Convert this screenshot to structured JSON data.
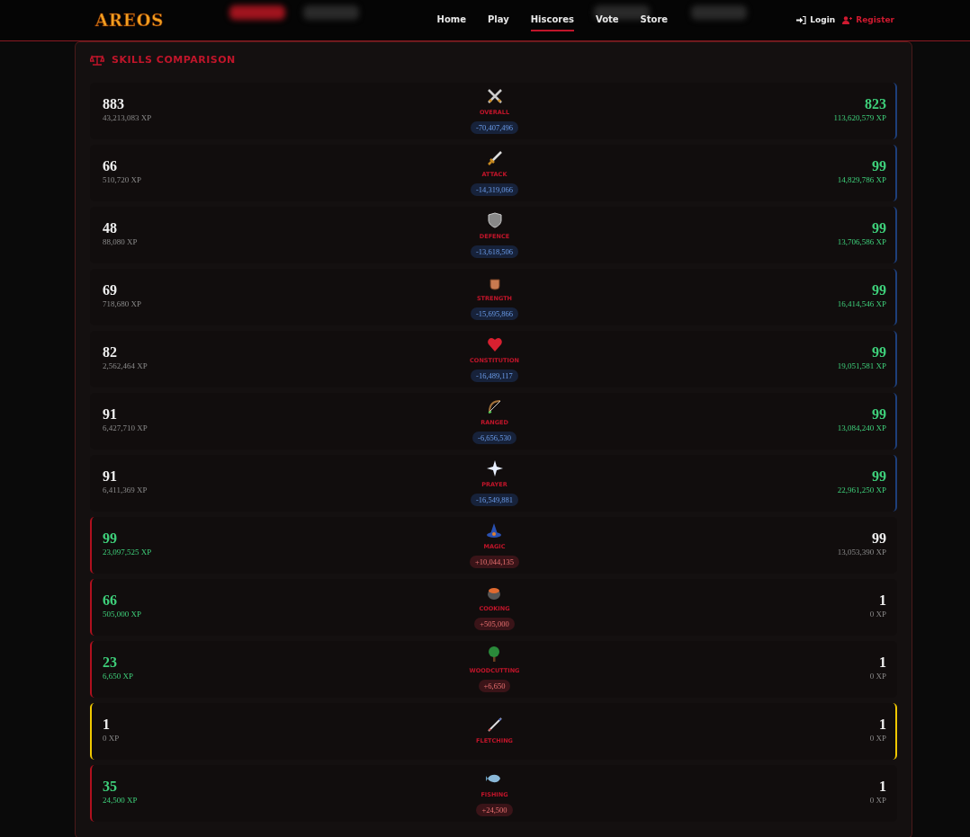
{
  "logo": "AREOS",
  "nav": [
    {
      "label": "Home",
      "selected": false
    },
    {
      "label": "Play",
      "selected": false
    },
    {
      "label": "Hiscores",
      "selected": true
    },
    {
      "label": "Vote",
      "selected": false
    },
    {
      "label": "Store",
      "selected": false
    }
  ],
  "auth": [
    {
      "label": "Login",
      "kind": "login"
    },
    {
      "label": "Register",
      "kind": "register"
    }
  ],
  "section_title": "SKILLS COMPARISON",
  "skills": [
    {
      "name": "OVERALL",
      "left_level": "883",
      "left_xp": "43,213,083 XP",
      "right_level": "823",
      "right_xp": "113,620,579 XP",
      "left_wins": false,
      "right_wins": true,
      "diff": "-70,407,496",
      "diff_positive": false
    },
    {
      "name": "ATTACK",
      "left_level": "66",
      "left_xp": "510,720 XP",
      "right_level": "99",
      "right_xp": "14,829,786 XP",
      "left_wins": false,
      "right_wins": true,
      "diff": "-14,319,066",
      "diff_positive": false
    },
    {
      "name": "DEFENCE",
      "left_level": "48",
      "left_xp": "88,080 XP",
      "right_level": "99",
      "right_xp": "13,706,586 XP",
      "left_wins": false,
      "right_wins": true,
      "diff": "-13,618,506",
      "diff_positive": false
    },
    {
      "name": "STRENGTH",
      "left_level": "69",
      "left_xp": "718,680 XP",
      "right_level": "99",
      "right_xp": "16,414,546 XP",
      "left_wins": false,
      "right_wins": true,
      "diff": "-15,695,866",
      "diff_positive": false
    },
    {
      "name": "CONSTITUTION",
      "left_level": "82",
      "left_xp": "2,562,464 XP",
      "right_level": "99",
      "right_xp": "19,051,581 XP",
      "left_wins": false,
      "right_wins": true,
      "diff": "-16,489,117",
      "diff_positive": false
    },
    {
      "name": "RANGED",
      "left_level": "91",
      "left_xp": "6,427,710 XP",
      "right_level": "99",
      "right_xp": "13,084,240 XP",
      "left_wins": false,
      "right_wins": true,
      "diff": "-6,656,530",
      "diff_positive": false
    },
    {
      "name": "PRAYER",
      "left_level": "91",
      "left_xp": "6,411,369 XP",
      "right_level": "99",
      "right_xp": "22,961,250 XP",
      "left_wins": false,
      "right_wins": true,
      "diff": "-16,549,881",
      "diff_positive": false
    },
    {
      "name": "MAGIC",
      "left_level": "99",
      "left_xp": "23,097,525 XP",
      "right_level": "99",
      "right_xp": "13,053,390 XP",
      "left_wins": true,
      "right_wins": false,
      "diff": "+10,044,135",
      "diff_positive": true
    },
    {
      "name": "COOKING",
      "left_level": "66",
      "left_xp": "505,000 XP",
      "right_level": "1",
      "right_xp": "0 XP",
      "left_wins": true,
      "right_wins": false,
      "diff": "+505,000",
      "diff_positive": true
    },
    {
      "name": "WOODCUTTING",
      "left_level": "23",
      "left_xp": "6,650 XP",
      "right_level": "1",
      "right_xp": "0 XP",
      "left_wins": true,
      "right_wins": false,
      "diff": "+6,650",
      "diff_positive": true
    },
    {
      "name": "FLETCHING",
      "left_level": "1",
      "left_xp": "0 XP",
      "right_level": "1",
      "right_xp": "0 XP",
      "left_wins": false,
      "right_wins": false
    },
    {
      "name": "FISHING",
      "left_level": "35",
      "left_xp": "24,500 XP",
      "right_level": "1",
      "right_xp": "0 XP",
      "left_wins": true,
      "right_wins": false,
      "diff": "+24,500",
      "diff_positive": true
    }
  ]
}
